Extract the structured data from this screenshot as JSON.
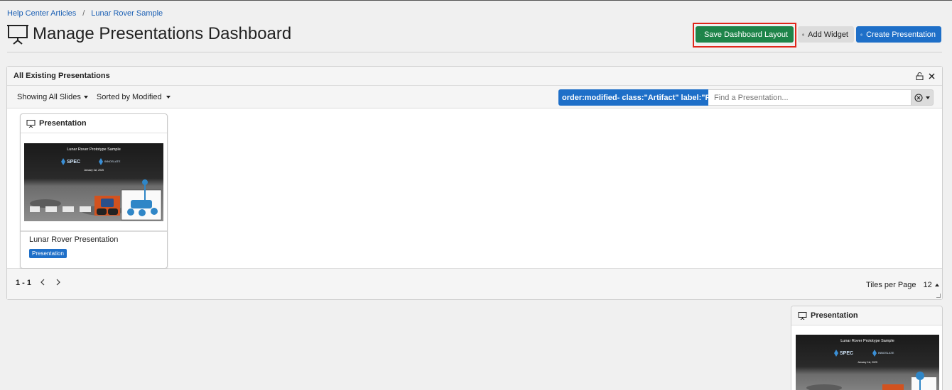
{
  "breadcrumb": {
    "items": [
      "Help Center Articles",
      "Lunar Rover Sample"
    ],
    "separator": "/"
  },
  "header": {
    "title": "Manage Presentations Dashboard",
    "title_icon": "presentation-icon",
    "buttons": {
      "save": "Save Dashboard Layout",
      "add_widget": "Add Widget",
      "create": "Create Presentation"
    }
  },
  "panel": {
    "title": "All Existing Presentations",
    "filters": {
      "showing": "Showing All Slides",
      "sorted": "Sorted by Modified"
    },
    "search": {
      "query": "order:modified- class:\"Artifact\" label:\"Prese...",
      "placeholder": "Find a Presentation...",
      "value": ""
    },
    "tiles": [
      {
        "header": "Presentation",
        "name": "Lunar Rover Presentation",
        "badge": "Presentation",
        "thumbnail": {
          "title": "Lunar Rover Prototype Sample",
          "logo_left": "SPEC",
          "logo_right": "INNOSLATE",
          "date": "January 1st, 2025"
        }
      }
    ],
    "footer": {
      "range": "1 - 1",
      "tiles_per_page_label": "Tiles per Page",
      "tiles_per_page": "12"
    }
  },
  "widget2": {
    "header": "Presentation",
    "thumbnail": {
      "title": "Lunar Rover Prototype Sample",
      "logo_left": "SPEC",
      "logo_right": "INNOSLATE",
      "date": "January 1st, 2025"
    }
  },
  "colors": {
    "primary": "#1e6fc8",
    "success": "#1e8449",
    "highlight": "#e0261b",
    "background": "#f0f0f0"
  }
}
